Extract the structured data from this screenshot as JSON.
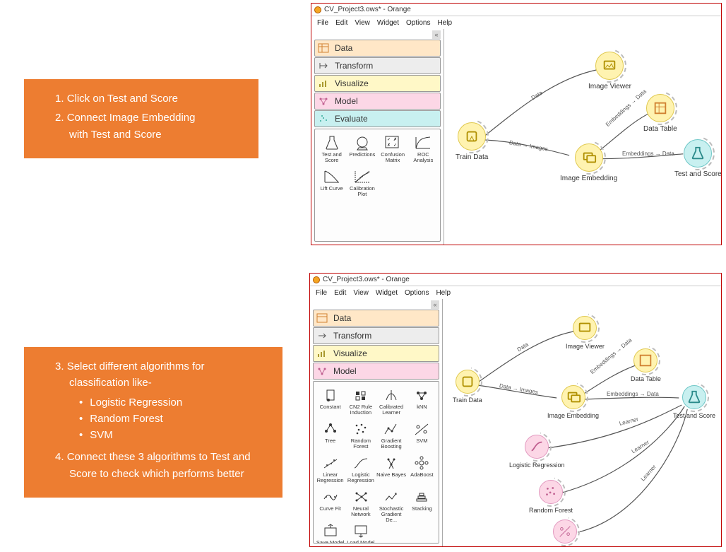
{
  "colors": {
    "accent": "#ED7D31"
  },
  "callout1": {
    "step1": "Click on Test and Score",
    "step2a": "Connect Image Embedding",
    "step2b": "with Test and Score"
  },
  "callout2": {
    "step3": "Select different algorithms for classification like-",
    "algo1": "Logistic Regression",
    "algo2": "Random Forest",
    "algo3": "SVM",
    "step4": "Connect these 3 algorithms to Test and Score to check which performs better"
  },
  "window": {
    "title": "CV_Project3.ows* - Orange",
    "menus": [
      "File",
      "Edit",
      "View",
      "Widget",
      "Options",
      "Help"
    ]
  },
  "drawers": {
    "data": "Data",
    "transform": "Transform",
    "visualize": "Visualize",
    "model": "Model",
    "evaluate": "Evaluate"
  },
  "evaluate_tools": [
    "Test and Score",
    "Predictions",
    "Confusion Matrix",
    "ROC Analysis",
    "Lift Curve",
    "Calibration Plot"
  ],
  "model_tools": [
    "Constant",
    "CN2 Rule Induction",
    "Calibrated Learner",
    "kNN",
    "Tree",
    "Random Forest",
    "Gradient Boosting",
    "SVM",
    "Linear Regression",
    "Logistic Regression",
    "Naive Bayes",
    "AdaBoost",
    "Curve Fit",
    "Neural Network",
    "Stochastic Gradient De...",
    "Stacking",
    "Save Model",
    "Load Model"
  ],
  "canvas1_nodes": {
    "train_data": "Train Data",
    "image_viewer": "Image Viewer",
    "image_embedding": "Image Embedding",
    "data_table": "Data Table",
    "test_score": "Test and Score"
  },
  "canvas1_edges": {
    "data": "Data",
    "data_images": "Data → Images",
    "embeddings_data": "Embeddings → Data",
    "embeddings_data2": "Embeddings → Data"
  },
  "canvas2_nodes": {
    "train_data": "Train Data",
    "image_viewer": "Image Viewer",
    "image_embedding": "Image Embedding",
    "data_table": "Data Table",
    "test_score": "Test and Score",
    "logistic": "Logistic Regression",
    "random_forest": "Random Forest",
    "svm": "SVM"
  },
  "canvas2_edges": {
    "data": "Data",
    "data_images": "Data → Images",
    "embeddings_data": "Embeddings → Data",
    "embeddings_data2": "Embeddings → Data",
    "learner": "Learner"
  }
}
